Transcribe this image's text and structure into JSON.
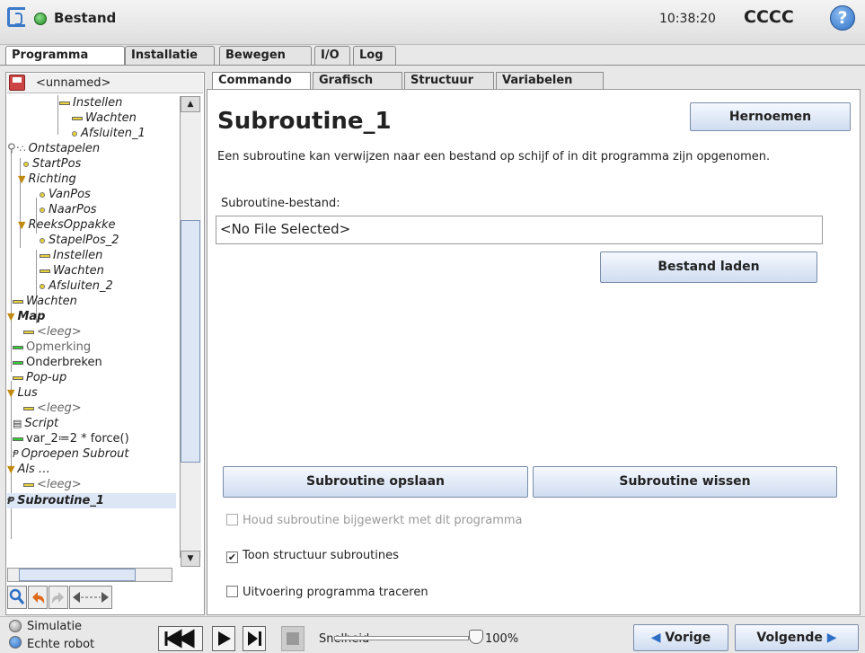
{
  "titlebar": {
    "title": "Bestand",
    "clock": "10:38:20",
    "robot_name": "CCCC",
    "help": "?"
  },
  "main_tabs": [
    {
      "label": "Programma",
      "active": true
    },
    {
      "label": "Installatie",
      "active": false
    },
    {
      "label": "Bewegen",
      "active": false
    },
    {
      "label": "I/O",
      "active": false
    },
    {
      "label": "Log",
      "active": false
    }
  ],
  "program": {
    "name": "<unnamed>"
  },
  "tree": [
    "Instellen",
    "Wachten",
    "Afsluiten_1",
    "Ontstapelen",
    "StartPos",
    "Richting",
    "VanPos",
    "NaarPos",
    "ReeksOppakke",
    "StapelPos_2",
    "Instellen",
    "Wachten",
    "Afsluiten_2",
    "Wachten",
    "Map",
    "<leeg>",
    "Opmerking",
    "Onderbreken",
    "Pop-up",
    "Lus",
    "<leeg>",
    "Script",
    "var_2≔2 * force()",
    "Oproepen Subrout",
    "Als …",
    "<leeg>",
    "Subroutine_1"
  ],
  "sub_tabs": [
    {
      "label": "Commando",
      "active": true
    },
    {
      "label": "Grafisch",
      "active": false
    },
    {
      "label": "Structuur",
      "active": false
    },
    {
      "label": "Variabelen",
      "active": false
    }
  ],
  "main": {
    "heading": "Subroutine_1",
    "rename_button": "Hernoemen",
    "description": "Een subroutine kan verwijzen naar een bestand op schijf of in dit programma zijn opgenomen.",
    "file_label": "Subroutine-bestand:",
    "file_value": "<No File Selected>",
    "load_button": "Bestand laden",
    "save_button": "Subroutine opslaan",
    "clear_button": "Subroutine wissen",
    "options": [
      {
        "label": "Houd subroutine bijgewerkt met dit programma",
        "checked": false,
        "disabled": true
      },
      {
        "label": "Toon structuur subroutines",
        "checked": true,
        "disabled": false
      },
      {
        "label": "Uitvoering programma traceren",
        "checked": false,
        "disabled": false
      }
    ]
  },
  "bottom": {
    "simulation": "Simulatie",
    "real_robot": "Echte robot",
    "speed_label": "Snelheid",
    "speed_value": "100%",
    "prev_button": "Vorige",
    "next_button": "Volgende"
  }
}
